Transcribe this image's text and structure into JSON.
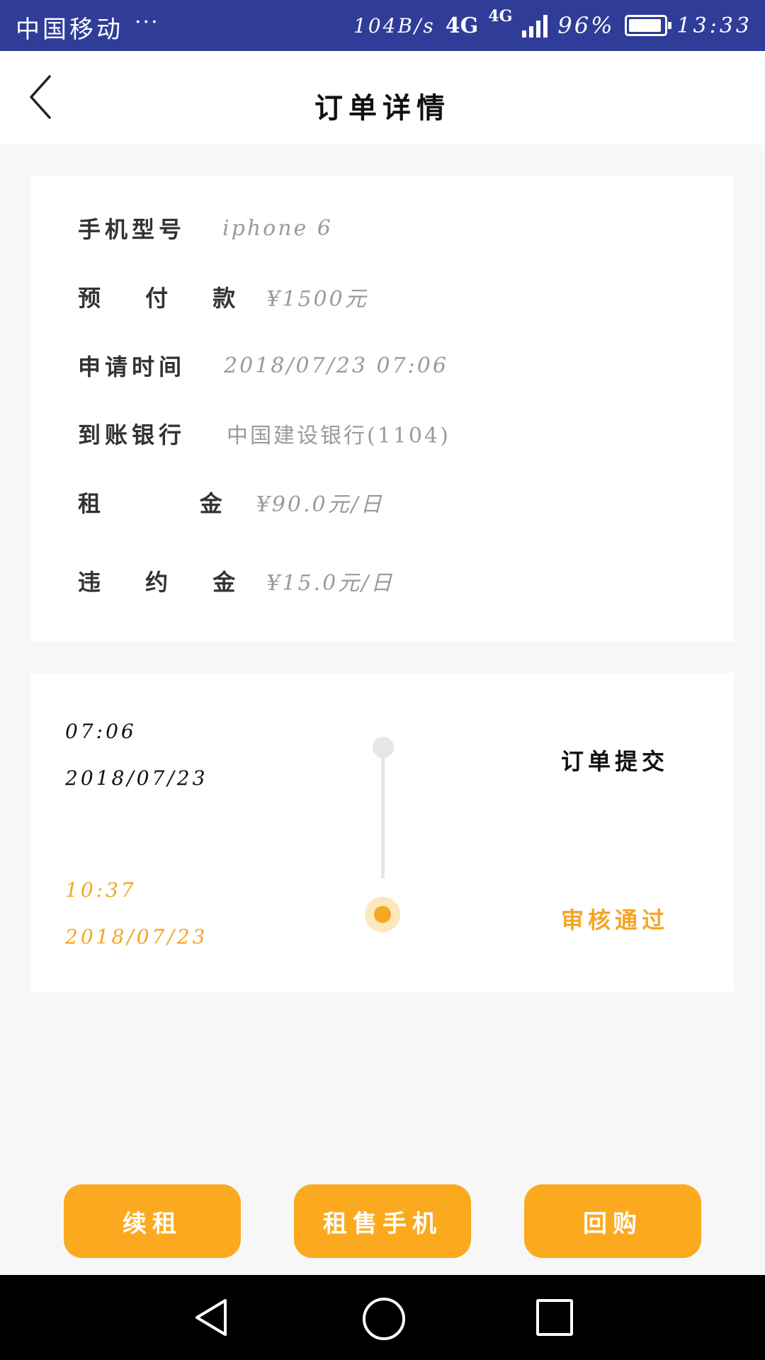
{
  "status_bar": {
    "carrier": "中国移动",
    "dots": "···",
    "net_speed": "104B/s",
    "network": "4G",
    "network2": "4G",
    "battery": "96%",
    "battery_level": 0.96,
    "time": "13:33"
  },
  "header": {
    "title": "订单详情",
    "back_icon": "chevron-left-icon"
  },
  "order_info": [
    {
      "label": "手机型号",
      "value": "iphone  6"
    },
    {
      "label": "预 付 款",
      "value": "¥1500元"
    },
    {
      "label": "申请时间",
      "value": "2018/07/23  07:06"
    },
    {
      "label": "到账银行",
      "value": "中国建设银行(1104)"
    },
    {
      "label": "租     金",
      "value": "¥90.0元/日"
    },
    {
      "label": "违 约 金",
      "value": "¥15.0元/日"
    }
  ],
  "timeline": [
    {
      "time": "07:06",
      "date": "2018/07/23",
      "status": "订单提交",
      "active": false
    },
    {
      "time": "10:37",
      "date": "2018/07/23",
      "status": "审核通过",
      "active": true
    }
  ],
  "actions": {
    "renew": "续租",
    "sell_phone": "租售手机",
    "buyback": "回购"
  },
  "colors": {
    "status_bar": "#2f3d98",
    "accent": "#f5a623",
    "button": "#fbaa1f"
  },
  "nav_bar": {
    "back_icon": "triangle-back-icon",
    "home_icon": "circle-home-icon",
    "recent_icon": "square-recent-icon"
  }
}
